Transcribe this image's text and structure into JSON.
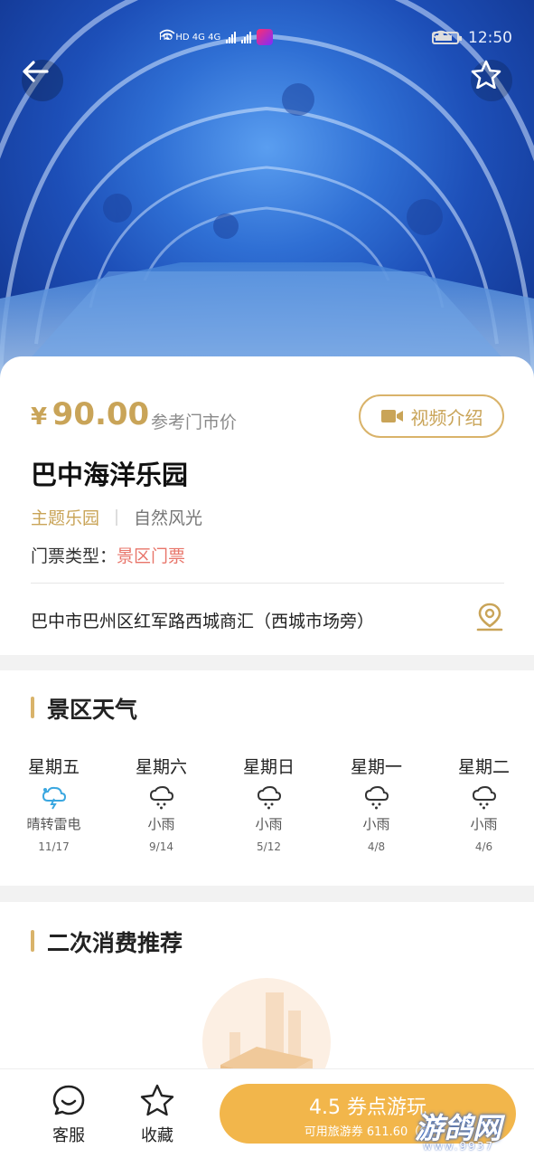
{
  "status_bar": {
    "left_indicators": "HD HD 4G 4G",
    "time": "12:50"
  },
  "header": {
    "back_icon": "arrow-left-icon",
    "favorite_icon": "star-outline-icon"
  },
  "info": {
    "price_symbol": "¥",
    "price_value": "90.00",
    "price_note": "参考门市价",
    "video_button": "视频介绍",
    "title": "巴中海洋乐园",
    "tag_primary": "主题乐园",
    "tag_secondary": "自然风光",
    "ticket_label": "门票类型：",
    "ticket_value": "景区门票",
    "address": "巴中市巴州区红军路西城商汇（西城市场旁）"
  },
  "weather": {
    "title": "景区天气",
    "days": [
      {
        "day": "星期五",
        "condition": "晴转雷电",
        "temp": "11/17",
        "icon": "thunderstorm-icon"
      },
      {
        "day": "星期六",
        "condition": "小雨",
        "temp": "9/14",
        "icon": "light-rain-icon"
      },
      {
        "day": "星期日",
        "condition": "小雨",
        "temp": "5/12",
        "icon": "light-rain-icon"
      },
      {
        "day": "星期一",
        "condition": "小雨",
        "temp": "4/8",
        "icon": "light-rain-icon"
      },
      {
        "day": "星期二",
        "condition": "小雨",
        "temp": "4/6",
        "icon": "light-rain-icon"
      }
    ]
  },
  "secondary": {
    "title": "二次消费推荐"
  },
  "bottom_bar": {
    "service_label": "客服",
    "favorite_label": "收藏",
    "cta_main": "4.5 券点游玩",
    "cta_sub": "可用旅游券 611.60（每"
  },
  "watermark": {
    "text": "游鸽网",
    "url": "www.9937"
  },
  "colors": {
    "accent": "#c9a458",
    "cta": "#f2b64b",
    "ticket_value": "#e8756a"
  }
}
